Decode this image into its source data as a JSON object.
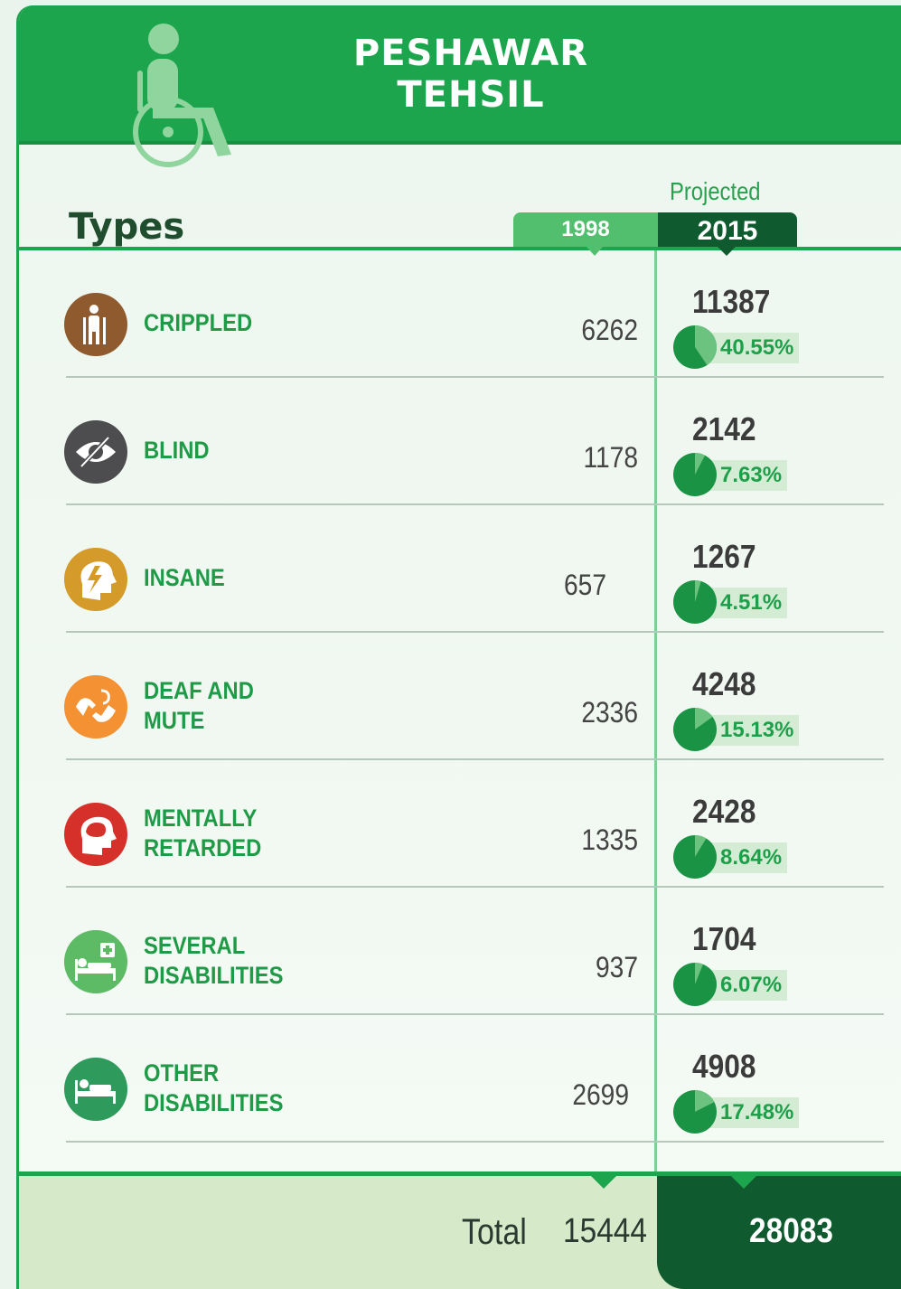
{
  "header": {
    "title_line1": "PESHAWAR",
    "title_line2": "TEHSIL",
    "icon": "wheelchair-icon"
  },
  "columns": {
    "types_label": "Types",
    "projected_label": "Projected",
    "year_1998": "1998",
    "year_2015": "2015"
  },
  "rows": [
    {
      "label_line1": "CRIPPLED",
      "label_line2": "",
      "v1998": "6262",
      "v2015": "11387",
      "pct": "40.55%",
      "pct_value": 40.55,
      "icon": "crutches-person-icon",
      "icon_color": "#8f5a2e"
    },
    {
      "label_line1": "BLIND",
      "label_line2": "",
      "v1998": "1178",
      "v2015": "2142",
      "pct": "7.63%",
      "pct_value": 7.63,
      "icon": "eye-slash-icon",
      "icon_color": "#4d4d4f"
    },
    {
      "label_line1": "INSANE",
      "label_line2": "",
      "v1998": "657",
      "v2015": "1267",
      "pct": "4.51%",
      "pct_value": 4.51,
      "icon": "head-lightning-icon",
      "icon_color": "#d49a2a"
    },
    {
      "label_line1": "DEAF AND",
      "label_line2": "MUTE",
      "v1998": "2336",
      "v2015": "4248",
      "pct": "15.13%",
      "pct_value": 15.13,
      "icon": "sign-language-icon",
      "icon_color": "#f39133"
    },
    {
      "label_line1": "MENTALLY",
      "label_line2": "RETARDED",
      "v1998": "1335",
      "v2015": "2428",
      "pct": "8.64%",
      "pct_value": 8.64,
      "icon": "brain-head-icon",
      "icon_color": "#d6302b"
    },
    {
      "label_line1": "SEVERAL",
      "label_line2": "DISABILITIES",
      "v1998": "937",
      "v2015": "1704",
      "pct": "6.07%",
      "pct_value": 6.07,
      "icon": "hospital-bed-plus-icon",
      "icon_color": "#5cbb64"
    },
    {
      "label_line1": "OTHER",
      "label_line2": "DISABILITIES",
      "v1998": "2699",
      "v2015": "4908",
      "pct": "17.48%",
      "pct_value": 17.48,
      "icon": "bed-person-icon",
      "icon_color": "#2e9a5c"
    }
  ],
  "footer": {
    "total_label": "Total",
    "total_1998": "15444",
    "total_2015": "28083"
  },
  "colors": {
    "brand_green": "#1ca54c",
    "dark_green": "#0f5a2e",
    "light_green": "#52bf6e"
  }
}
